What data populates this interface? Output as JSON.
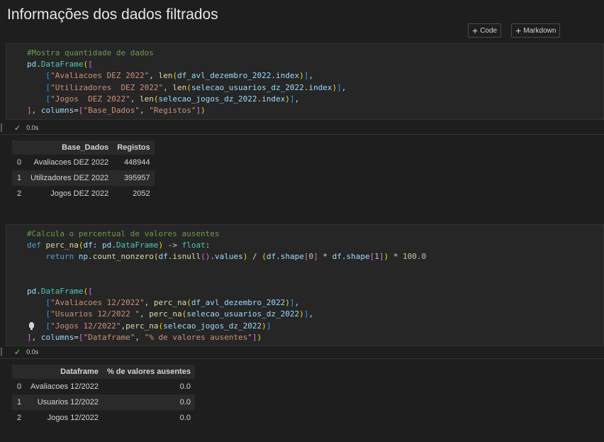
{
  "heading": "Informações dos dados filtrados",
  "toolbar": {
    "code_label": "Code",
    "markdown_label": "Markdown"
  },
  "cell1": {
    "lines": [
      [
        {
          "t": "#Mostra quantidade de dados",
          "c": "c-com"
        }
      ],
      [
        {
          "t": "pd",
          "c": "c-var"
        },
        {
          "t": "."
        },
        {
          "t": "DataFrame",
          "c": "c-cls"
        },
        {
          "t": "(",
          "c": "c-br1"
        },
        {
          "t": "[",
          "c": "c-br2"
        }
      ],
      [
        {
          "t": "    "
        },
        {
          "t": "[",
          "c": "c-br3"
        },
        {
          "t": "\"Avaliacoes DEZ 2022\"",
          "c": "c-str"
        },
        {
          "t": ", "
        },
        {
          "t": "len",
          "c": "c-fn"
        },
        {
          "t": "(",
          "c": "c-br1"
        },
        {
          "t": "df_avl_dezembro_2022",
          "c": "c-var"
        },
        {
          "t": "."
        },
        {
          "t": "index",
          "c": "c-var"
        },
        {
          "t": ")",
          "c": "c-br1"
        },
        {
          "t": "]",
          "c": "c-br3"
        },
        {
          "t": ","
        }
      ],
      [
        {
          "t": "    "
        },
        {
          "t": "[",
          "c": "c-br3"
        },
        {
          "t": "\"Utilizadores  DEZ 2022\"",
          "c": "c-str"
        },
        {
          "t": ", "
        },
        {
          "t": "len",
          "c": "c-fn"
        },
        {
          "t": "(",
          "c": "c-br1"
        },
        {
          "t": "selecao_usuarios_dz_2022",
          "c": "c-var"
        },
        {
          "t": "."
        },
        {
          "t": "index",
          "c": "c-var"
        },
        {
          "t": ")",
          "c": "c-br1"
        },
        {
          "t": "]",
          "c": "c-br3"
        },
        {
          "t": ","
        }
      ],
      [
        {
          "t": "    "
        },
        {
          "t": "[",
          "c": "c-br3"
        },
        {
          "t": "\"Jogos  DEZ 2022\"",
          "c": "c-str"
        },
        {
          "t": ", "
        },
        {
          "t": "len",
          "c": "c-fn"
        },
        {
          "t": "(",
          "c": "c-br1"
        },
        {
          "t": "selecao_jogos_dz_2022",
          "c": "c-var"
        },
        {
          "t": "."
        },
        {
          "t": "index",
          "c": "c-var"
        },
        {
          "t": ")",
          "c": "c-br1"
        },
        {
          "t": "]",
          "c": "c-br3"
        },
        {
          "t": ","
        }
      ],
      [
        {
          "t": "]",
          "c": "c-br2"
        },
        {
          "t": ", "
        },
        {
          "t": "columns",
          "c": "c-var"
        },
        {
          "t": "="
        },
        {
          "t": "[",
          "c": "c-br2"
        },
        {
          "t": "\"Base_Dados\"",
          "c": "c-str"
        },
        {
          "t": ", "
        },
        {
          "t": "\"Registos\"",
          "c": "c-str"
        },
        {
          "t": "]",
          "c": "c-br2"
        },
        {
          "t": ")",
          "c": "c-br1"
        }
      ]
    ],
    "time": "0.0s"
  },
  "table1": {
    "headers": [
      "",
      "Base_Dados",
      "Registos"
    ],
    "rows": [
      [
        "0",
        "Avaliacoes DEZ 2022",
        "448944"
      ],
      [
        "1",
        "Utilizadores DEZ 2022",
        "395957"
      ],
      [
        "2",
        "Jogos DEZ 2022",
        "2052"
      ]
    ]
  },
  "cell2": {
    "lines": [
      [
        {
          "t": "#Calcula o percentual de valores ausentes",
          "c": "c-com"
        }
      ],
      [
        {
          "t": "def ",
          "c": "c-kw"
        },
        {
          "t": "perc_na",
          "c": "c-fn"
        },
        {
          "t": "(",
          "c": "c-br1"
        },
        {
          "t": "df",
          "c": "c-var"
        },
        {
          "t": ": "
        },
        {
          "t": "pd",
          "c": "c-var"
        },
        {
          "t": "."
        },
        {
          "t": "DataFrame",
          "c": "c-cls"
        },
        {
          "t": ")",
          "c": "c-br1"
        },
        {
          "t": " -> "
        },
        {
          "t": "float",
          "c": "c-cls"
        },
        {
          "t": ":"
        }
      ],
      [
        {
          "t": "    "
        },
        {
          "t": "return ",
          "c": "c-kw"
        },
        {
          "t": "np",
          "c": "c-var"
        },
        {
          "t": "."
        },
        {
          "t": "count_nonzero",
          "c": "c-fn"
        },
        {
          "t": "(",
          "c": "c-br1"
        },
        {
          "t": "df",
          "c": "c-var"
        },
        {
          "t": "."
        },
        {
          "t": "isnull",
          "c": "c-fn"
        },
        {
          "t": "()",
          "c": "c-br2"
        },
        {
          "t": "."
        },
        {
          "t": "values",
          "c": "c-var"
        },
        {
          "t": ")",
          "c": "c-br1"
        },
        {
          "t": " / "
        },
        {
          "t": "(",
          "c": "c-br1"
        },
        {
          "t": "df",
          "c": "c-var"
        },
        {
          "t": "."
        },
        {
          "t": "shape",
          "c": "c-var"
        },
        {
          "t": "[",
          "c": "c-br2"
        },
        {
          "t": "0",
          "c": "c-num"
        },
        {
          "t": "]",
          "c": "c-br2"
        },
        {
          "t": " * "
        },
        {
          "t": "df",
          "c": "c-var"
        },
        {
          "t": "."
        },
        {
          "t": "shape",
          "c": "c-var"
        },
        {
          "t": "[",
          "c": "c-br2"
        },
        {
          "t": "1",
          "c": "c-num"
        },
        {
          "t": "]",
          "c": "c-br2"
        },
        {
          "t": ")",
          "c": "c-br1"
        },
        {
          "t": " * "
        },
        {
          "t": "100.0",
          "c": "c-num"
        }
      ],
      [
        {
          "t": ""
        }
      ],
      [
        {
          "t": ""
        }
      ],
      [
        {
          "t": "pd",
          "c": "c-var"
        },
        {
          "t": "."
        },
        {
          "t": "DataFrame",
          "c": "c-cls"
        },
        {
          "t": "(",
          "c": "c-br1"
        },
        {
          "t": "[",
          "c": "c-br2"
        }
      ],
      [
        {
          "t": "    "
        },
        {
          "t": "[",
          "c": "c-br3"
        },
        {
          "t": "\"Avaliacoes 12/2022\"",
          "c": "c-str"
        },
        {
          "t": ", "
        },
        {
          "t": "perc_na",
          "c": "c-fn"
        },
        {
          "t": "(",
          "c": "c-br1"
        },
        {
          "t": "df_avl_dezembro_2022",
          "c": "c-var"
        },
        {
          "t": ")",
          "c": "c-br1"
        },
        {
          "t": "]",
          "c": "c-br3"
        },
        {
          "t": ","
        }
      ],
      [
        {
          "t": "    "
        },
        {
          "t": "[",
          "c": "c-br3"
        },
        {
          "t": "\"Usuarios 12/2022 \"",
          "c": "c-str"
        },
        {
          "t": ", "
        },
        {
          "t": "perc_na",
          "c": "c-fn"
        },
        {
          "t": "(",
          "c": "c-br1"
        },
        {
          "t": "selecao_usuarios_dz_2022",
          "c": "c-var"
        },
        {
          "t": ")",
          "c": "c-br1"
        },
        {
          "t": "]",
          "c": "c-br3"
        },
        {
          "t": ","
        }
      ],
      [
        {
          "t": "    "
        },
        {
          "t": "[",
          "c": "c-br3"
        },
        {
          "t": "\"Jogos 12/2022\"",
          "c": "c-str"
        },
        {
          "t": ","
        },
        {
          "t": "perc_na",
          "c": "c-fn"
        },
        {
          "t": "(",
          "c": "c-br1"
        },
        {
          "t": "selecao_jogos_dz_2022",
          "c": "c-var"
        },
        {
          "t": ")",
          "c": "c-br1"
        },
        {
          "t": "]",
          "c": "c-br3"
        }
      ],
      [
        {
          "t": "]",
          "c": "c-br2"
        },
        {
          "t": ", "
        },
        {
          "t": "columns",
          "c": "c-var"
        },
        {
          "t": "="
        },
        {
          "t": "[",
          "c": "c-br2"
        },
        {
          "t": "\"Dataframe\"",
          "c": "c-str"
        },
        {
          "t": ", "
        },
        {
          "t": "\"% de valores ausentes\"",
          "c": "c-str"
        },
        {
          "t": "]",
          "c": "c-br2"
        },
        {
          "t": ")",
          "c": "c-br1"
        }
      ]
    ],
    "time": "0.0s"
  },
  "table2": {
    "headers": [
      "",
      "Dataframe",
      "% de valores ausentes"
    ],
    "rows": [
      [
        "0",
        "Avaliacoes 12/2022",
        "0.0"
      ],
      [
        "1",
        "Usuarios 12/2022",
        "0.0"
      ],
      [
        "2",
        "Jogos 12/2022",
        "0.0"
      ]
    ]
  }
}
